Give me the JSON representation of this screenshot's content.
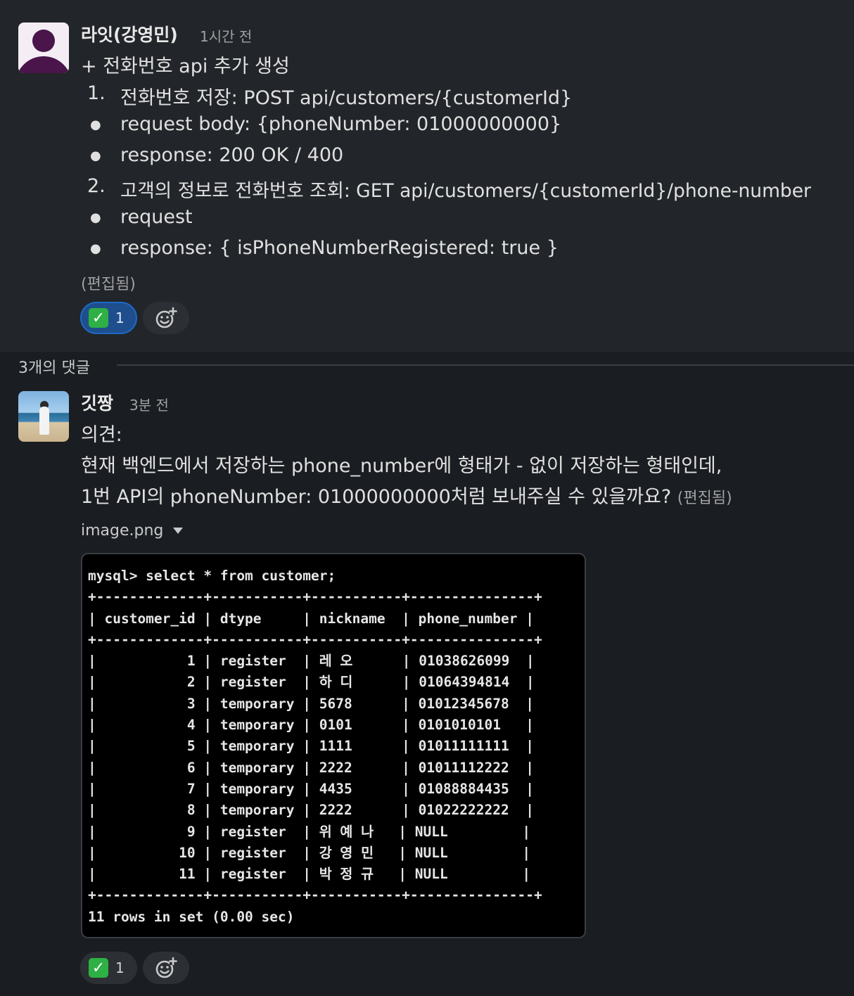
{
  "message1": {
    "sender": "라잇(강영민)",
    "time": "1시간 전",
    "lines": {
      "intro": "+ 전화번호 api 추가 생성",
      "item1_marker": "1.",
      "item1": "전화번호 저장: POST api/customers/{customerId}",
      "bullet1": "request body: {phoneNumber: 01000000000}",
      "bullet2": "response: 200 OK / 400",
      "item2_marker": "2.",
      "item2": "고객의 정보로 전화번호 조회: GET api/customers/{customerId}/phone-number",
      "bullet3": "request",
      "bullet4": "response: { isPhoneNumberRegistered: true }",
      "bullet_marker": "●"
    },
    "edited": "(편집됨)",
    "reaction": {
      "emoji": "✓",
      "count": "1"
    }
  },
  "thread": {
    "reply_count_label": "3개의 댓글"
  },
  "message2": {
    "sender": "깃짱",
    "time": "3분 전",
    "line1": "의견:",
    "line2": "현재 백엔드에서 저장하는 phone_number에 형태가 - 없이 저장하는 형태인데,",
    "line3": "1번 API의 phoneNumber: 01000000000처럼 보내주실 수 있을까요?",
    "edited": "(편집됨)",
    "attachment_name": "image.png",
    "reaction": {
      "emoji": "✓",
      "count": "1"
    }
  },
  "terminal": {
    "command": "mysql> select * from customer;",
    "border": "+-------------+-----------+-----------+---------------+",
    "header": "| customer_id | dtype     | nickname  | phone_number |",
    "rows": [
      "|           1 | register  | 레 오      | 01038626099  |",
      "|           2 | register  | 하 디      | 01064394814  |",
      "|           3 | temporary | 5678      | 01012345678  |",
      "|           4 | temporary | 0101      | 0101010101   |",
      "|           5 | temporary | 1111      | 01011111111  |",
      "|           6 | temporary | 2222      | 01011112222  |",
      "|           7 | temporary | 4435      | 01088884435  |",
      "|           8 | temporary | 2222      | 01022222222  |",
      "|           9 | register  | 위 예 나   | NULL         |",
      "|          10 | register  | 강 영 민   | NULL         |",
      "|          11 | register  | 박 정 규   | NULL         |"
    ],
    "footer": "11 rows in set (0.00 sec)"
  }
}
